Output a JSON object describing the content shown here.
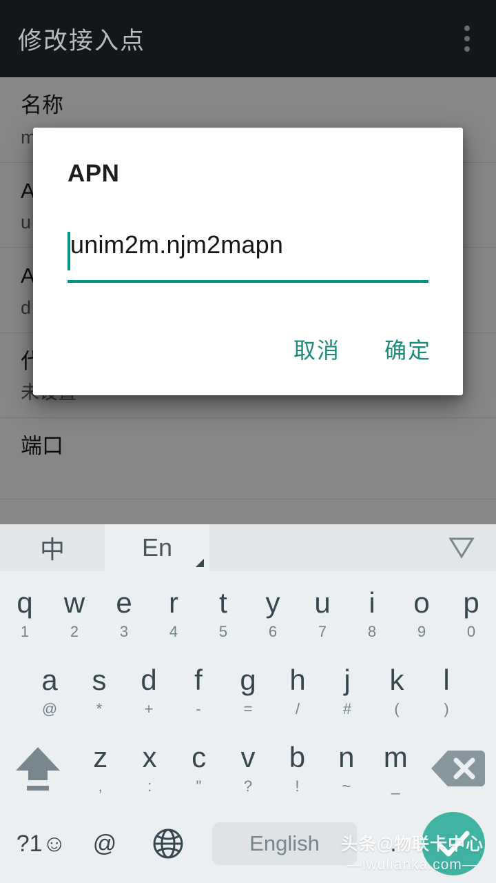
{
  "appbar": {
    "title": "修改接入点",
    "overflow_icon": "more-vertical-icon"
  },
  "settings_list": [
    {
      "title": "名称",
      "subtitle": "m"
    },
    {
      "title": "A",
      "subtitle": "u"
    },
    {
      "title": "A",
      "subtitle": "d"
    },
    {
      "title": "代理",
      "subtitle": "未设置"
    },
    {
      "title": "端口",
      "subtitle": ""
    }
  ],
  "dialog": {
    "title": "APN",
    "input_value": "unim2m.njm2mapn",
    "input_placeholder": "",
    "cancel_label": "取消",
    "ok_label": "确定",
    "accent_color": "#1b8a7a",
    "underline_color": "#009688"
  },
  "keyboard": {
    "tabs": [
      {
        "label": "中",
        "active": false
      },
      {
        "label": "En",
        "active": true
      }
    ],
    "hide_icon": "chevron-down-icon",
    "rows": [
      [
        {
          "main": "q",
          "sub": "1"
        },
        {
          "main": "w",
          "sub": "2"
        },
        {
          "main": "e",
          "sub": "3"
        },
        {
          "main": "r",
          "sub": "4"
        },
        {
          "main": "t",
          "sub": "5"
        },
        {
          "main": "y",
          "sub": "6"
        },
        {
          "main": "u",
          "sub": "7"
        },
        {
          "main": "i",
          "sub": "8"
        },
        {
          "main": "o",
          "sub": "9"
        },
        {
          "main": "p",
          "sub": "0"
        }
      ],
      [
        {
          "main": "a",
          "sub": "@"
        },
        {
          "main": "s",
          "sub": "*"
        },
        {
          "main": "d",
          "sub": "+"
        },
        {
          "main": "f",
          "sub": "-"
        },
        {
          "main": "g",
          "sub": "="
        },
        {
          "main": "h",
          "sub": "/"
        },
        {
          "main": "j",
          "sub": "#"
        },
        {
          "main": "k",
          "sub": "("
        },
        {
          "main": "l",
          "sub": ")"
        }
      ],
      [
        {
          "main": "z",
          "sub": ","
        },
        {
          "main": "x",
          "sub": ":"
        },
        {
          "main": "c",
          "sub": "\""
        },
        {
          "main": "v",
          "sub": "?"
        },
        {
          "main": "b",
          "sub": "!"
        },
        {
          "main": "n",
          "sub": "~"
        },
        {
          "main": "m",
          "sub": "_"
        }
      ]
    ],
    "shift_icon": "shift-arrow-icon",
    "backspace_icon": "backspace-icon",
    "bottom": {
      "symbols_label": "?1☺",
      "at_label": "@",
      "globe_icon": "globe-icon",
      "space_label": "English",
      "period_label": ".",
      "enter_icon": "check-icon",
      "enter_color": "#41b3a3"
    }
  },
  "watermark": {
    "line1": "头条@物联卡中心",
    "line2": "—iwulianka.com—"
  }
}
